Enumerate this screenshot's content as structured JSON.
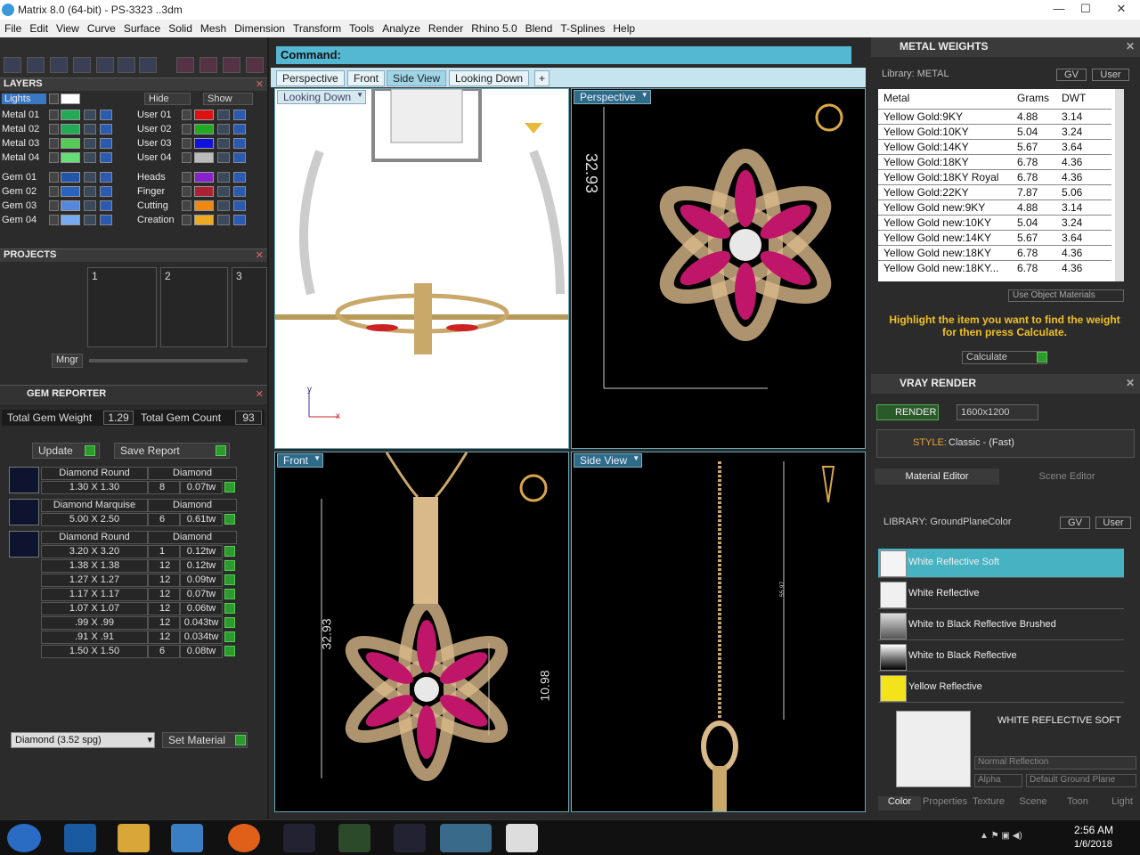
{
  "window": {
    "title": "Matrix 8.0 (64-bit) - PS-3323 ..3dm",
    "min": "—",
    "max": "☐",
    "close": "✕"
  },
  "menu": [
    "File",
    "Edit",
    "View",
    "Curve",
    "Surface",
    "Solid",
    "Mesh",
    "Dimension",
    "Transform",
    "Tools",
    "Analyze",
    "Render",
    "Rhino 5.0",
    "Blend",
    "T-Splines",
    "Help"
  ],
  "layers": {
    "title": "LAYERS",
    "lights": "Lights",
    "hide": "Hide",
    "show": "Show",
    "left": [
      {
        "name": "Metal 01",
        "color": "#22aa55"
      },
      {
        "name": "Metal 02",
        "color": "#22aa55"
      },
      {
        "name": "Metal 03",
        "color": "#55cc55"
      },
      {
        "name": "Metal 04",
        "color": "#66dd77"
      },
      {
        "name": "Gem 01",
        "color": "#2255aa"
      },
      {
        "name": "Gem 02",
        "color": "#2a62c0"
      },
      {
        "name": "Gem 03",
        "color": "#5588dd"
      },
      {
        "name": "Gem 04",
        "color": "#77aaee"
      }
    ],
    "right": [
      {
        "name": "User 01",
        "color": "#dd1111"
      },
      {
        "name": "User 02",
        "color": "#22aa22"
      },
      {
        "name": "User 03",
        "color": "#1111dd"
      },
      {
        "name": "User 04",
        "color": "#bbbbbb"
      },
      {
        "name": "Heads",
        "color": "#8822cc"
      },
      {
        "name": "Finger",
        "color": "#aa2233"
      },
      {
        "name": "Cutting",
        "color": "#ee8811"
      },
      {
        "name": "Creation",
        "color": "#eeaa22"
      }
    ]
  },
  "projects": {
    "title": "PROJECTS",
    "slots": [
      "1",
      "2",
      "3"
    ],
    "mngr": "Mngr"
  },
  "gem": {
    "title": "GEM REPORTER",
    "weight_label": "Total Gem Weight",
    "weight": "1.29",
    "count_label": "Total Gem Count",
    "count": "93",
    "update": "Update",
    "save": "Save Report",
    "groups": [
      {
        "shape": "Diamond Round",
        "type": "Diamond",
        "rows": [
          [
            "1.30 X 1.30",
            "8",
            "0.07tw"
          ]
        ]
      },
      {
        "shape": "Diamond Marquise",
        "type": "Diamond",
        "rows": [
          [
            "5.00 X 2.50",
            "6",
            "0.61tw"
          ]
        ]
      },
      {
        "shape": "Diamond Round",
        "type": "Diamond",
        "rows": [
          [
            "3.20 X 3.20",
            "1",
            "0.12tw"
          ],
          [
            "1.38 X 1.38",
            "12",
            "0.12tw"
          ],
          [
            "1.27 X 1.27",
            "12",
            "0.09tw"
          ],
          [
            "1.17 X 1.17",
            "12",
            "0.07tw"
          ],
          [
            "1.07 X 1.07",
            "12",
            "0.06tw"
          ],
          [
            ".99 X .99",
            "12",
            "0.043tw"
          ],
          [
            ".91 X .91",
            "12",
            "0.034tw"
          ],
          [
            "1.50 X 1.50",
            "6",
            "0.08tw"
          ]
        ]
      }
    ],
    "material_select": "Diamond    (3.52 spg)",
    "set_material": "Set Material"
  },
  "command": {
    "label": "Command:"
  },
  "tabs": [
    "Perspective",
    "Front",
    "Side View",
    "Looking Down"
  ],
  "viewports": {
    "tl": "Looking Down",
    "tr": "Perspective",
    "bl": "Front",
    "br": "Side View"
  },
  "dims": {
    "persp": "32.93",
    "front_h": "32.93",
    "front_w": "10.98",
    "side": "55.97"
  },
  "metal": {
    "title": "METAL WEIGHTS",
    "library": "Library: METAL",
    "gv": "GV",
    "user": "User",
    "headers": [
      "Metal",
      "Grams",
      "DWT"
    ],
    "rows": [
      [
        "Yellow Gold:9KY",
        "4.88",
        "3.14"
      ],
      [
        "Yellow Gold:10KY",
        "5.04",
        "3.24"
      ],
      [
        "Yellow Gold:14KY",
        "5.67",
        "3.64"
      ],
      [
        "Yellow Gold:18KY",
        "6.78",
        "4.36"
      ],
      [
        "Yellow Gold:18KY Royal",
        "6.78",
        "4.36"
      ],
      [
        "Yellow Gold:22KY",
        "7.87",
        "5.06"
      ],
      [
        "Yellow Gold new:9KY",
        "4.88",
        "3.14"
      ],
      [
        "Yellow Gold new:10KY",
        "5.04",
        "3.24"
      ],
      [
        "Yellow Gold new:14KY",
        "5.67",
        "3.64"
      ],
      [
        "Yellow Gold new:18KY",
        "6.78",
        "4.36"
      ],
      [
        "Yellow Gold new:18KY...",
        "6.78",
        "4.36"
      ]
    ],
    "use_obj": "Use Object Materials",
    "hint": "Highlight the item you want to find the weight for then press Calculate.",
    "calculate": "Calculate"
  },
  "vray": {
    "title": "VRAY RENDER",
    "render": "RENDER",
    "resolution": "1600x1200",
    "style_label": "STYLE:",
    "style": "Classic - (Fast)",
    "tab_editor": "Material Editor",
    "tab_scene": "Scene Editor",
    "library": "LIBRARY: GroundPlaneColor",
    "gv": "GV",
    "user": "User",
    "materials": [
      {
        "name": "White Reflective Soft",
        "selected": true
      },
      {
        "name": "White Reflective"
      },
      {
        "name": "White to Black Reflective Brushed"
      },
      {
        "name": "White to Black Reflective"
      },
      {
        "name": "Yellow Reflective"
      }
    ],
    "preview_title": "WHITE REFLECTIVE SOFT",
    "reflection": "Normal Reflection",
    "alpha": "Alpha",
    "ground": "Default Ground Plane",
    "bottom_tabs": [
      "Color",
      "Properties",
      "Texture",
      "Scene",
      "Toon",
      "Light"
    ]
  },
  "clock": {
    "time": "2:56 AM",
    "date": "1/6/2018"
  }
}
